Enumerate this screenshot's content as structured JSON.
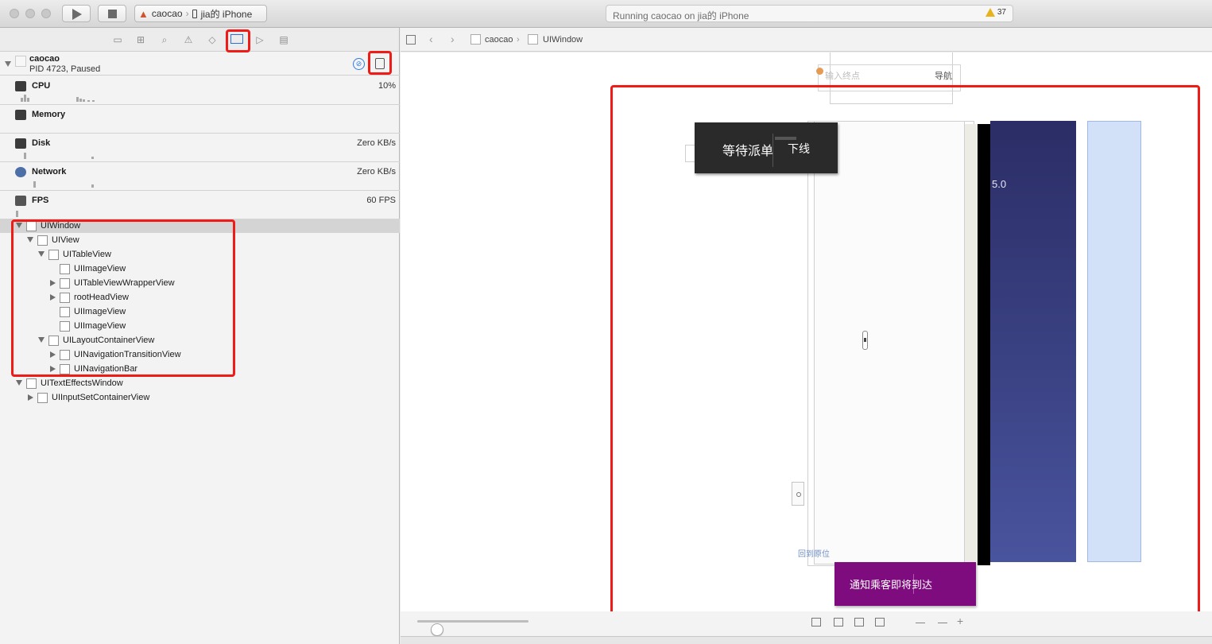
{
  "toolbar": {
    "scheme_app": "caocao",
    "scheme_device": "jia的 iPhone",
    "activity_status": "Running caocao on jia的 iPhone",
    "warning_count": "37"
  },
  "navigator": {
    "active_tab": "debug-navigator",
    "process": {
      "name": "caocao",
      "status": "PID 4723, Paused"
    },
    "gauges": [
      {
        "label": "CPU",
        "value": "10%"
      },
      {
        "label": "Memory",
        "value": ""
      },
      {
        "label": "Disk",
        "value": "Zero KB/s"
      },
      {
        "label": "Network",
        "value": "Zero KB/s"
      },
      {
        "label": "FPS",
        "value": "60 FPS"
      }
    ],
    "tree": [
      {
        "label": "UIWindow"
      },
      {
        "label": "UIView"
      },
      {
        "label": "UITableView"
      },
      {
        "label": "UIImageView"
      },
      {
        "label": "UITableViewWrapperView"
      },
      {
        "label": "rootHeadView"
      },
      {
        "label": "UIImageView"
      },
      {
        "label": "UIImageView"
      },
      {
        "label": "UILayoutContainerView"
      },
      {
        "label": "UINavigationTransitionView"
      },
      {
        "label": "UINavigationBar"
      },
      {
        "label": "UITextEffectsWindow"
      },
      {
        "label": "UIInputSetContainerView"
      }
    ]
  },
  "jumpbar": {
    "crumbs": [
      "caocao",
      "UIWindow"
    ]
  },
  "canvas": {
    "pill_left": "等待派单",
    "pill_right": "下线",
    "score": "5.0",
    "notify_button": "通知乘客即将到达",
    "search_placeholder": "输入终点",
    "nav_button": "导航",
    "back_link": "回到原位"
  },
  "colors": {
    "highlight": "#f01a16",
    "pill_bg": "#2a2a2a",
    "navy": "#2b2d66",
    "purple": "#7e0c7e",
    "light_blue": "#d2e1f8",
    "warning": "#e7b21c"
  },
  "zoom_slider": {
    "value": 0.18
  }
}
